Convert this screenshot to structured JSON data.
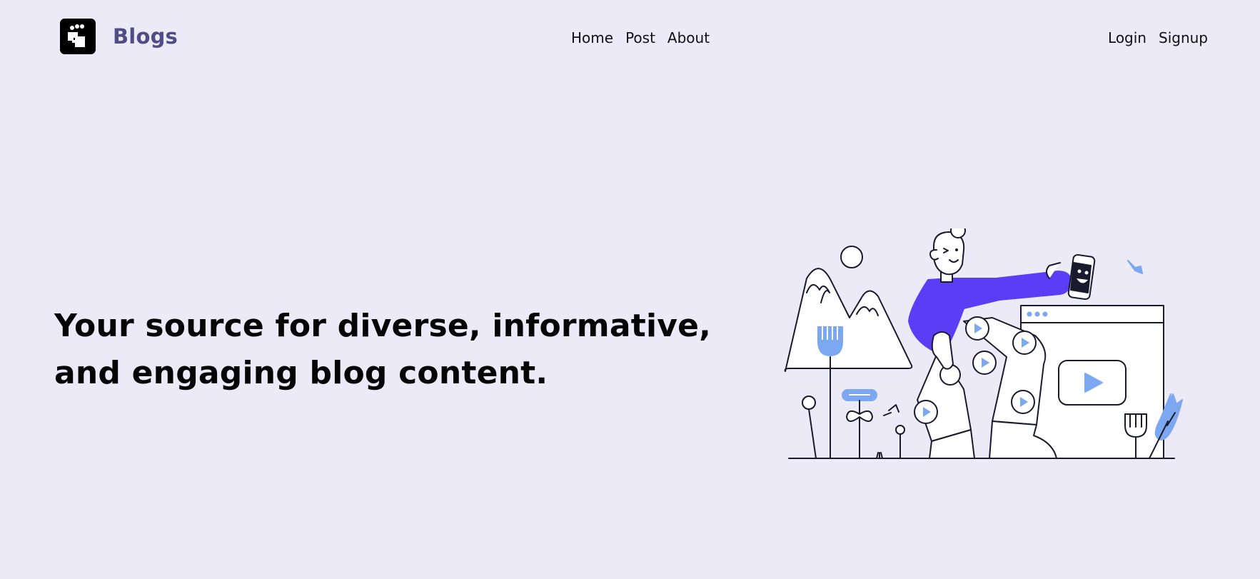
{
  "header": {
    "brand_name": "Blogs",
    "logo_icon": "community-logo-icon",
    "nav_center": [
      {
        "label": "Home"
      },
      {
        "label": "Post"
      },
      {
        "label": "About"
      }
    ],
    "nav_right": [
      {
        "label": "Login"
      },
      {
        "label": "Signup"
      }
    ]
  },
  "hero": {
    "headline_line1": "Your source for diverse, informative,",
    "headline_line2": "and engaging blog content."
  },
  "colors": {
    "background": "#eceaf7",
    "brand_text": "#524c86",
    "accent_purple": "#5b3df5",
    "accent_blue": "#7ba8f0"
  }
}
